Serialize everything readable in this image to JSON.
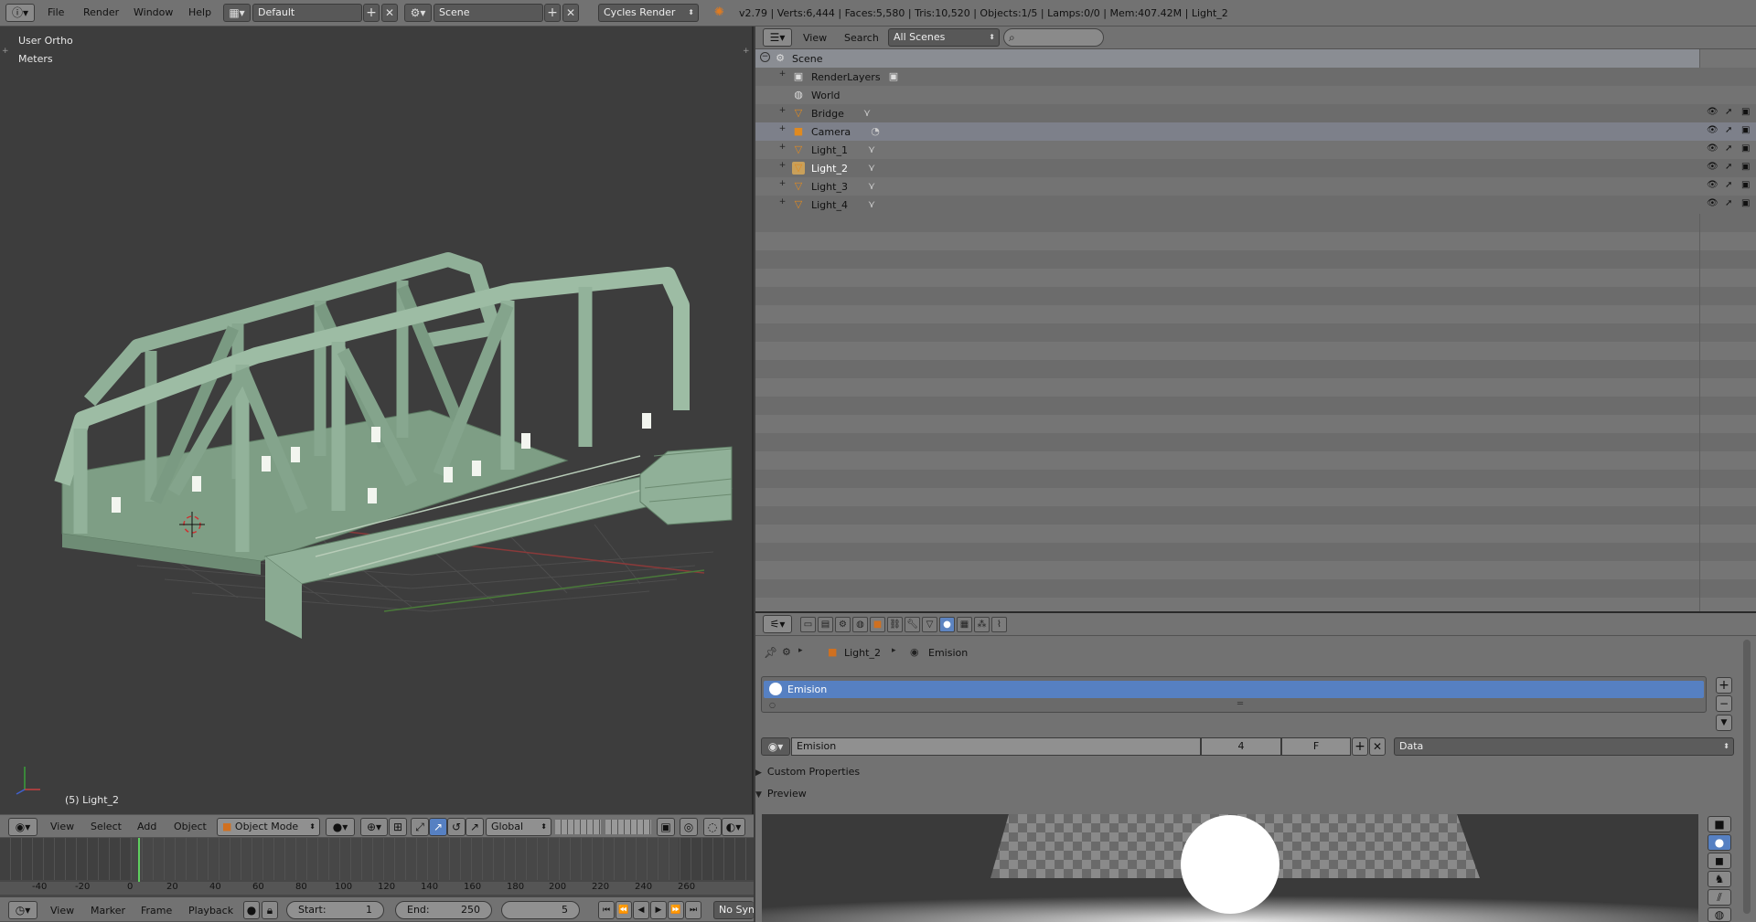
{
  "info_header": {
    "menus": [
      "File",
      "Render",
      "Window",
      "Help"
    ],
    "screen_layout": "Default",
    "scene": "Scene",
    "render_engine": "Cycles Render",
    "stats": "v2.79 | Verts:6,444 | Faces:5,580 | Tris:10,520 | Objects:1/5 | Lamps:0/0 | Mem:407.42M | Light_2"
  },
  "viewport": {
    "view_name": "User Ortho",
    "units": "Meters",
    "object_label": "(5) Light_2",
    "menus": [
      "View",
      "Select",
      "Add",
      "Object"
    ],
    "mode": "Object Mode",
    "orientation": "Global"
  },
  "outliner": {
    "menus": [
      "View",
      "Search"
    ],
    "display_mode": "All Scenes",
    "search_placeholder": "",
    "items": [
      {
        "label": "Scene",
        "icon": "scene-icon",
        "level": 0,
        "expanded": true
      },
      {
        "label": "RenderLayers",
        "icon": "renderlayers-icon",
        "level": 1
      },
      {
        "label": "World",
        "icon": "world-icon",
        "level": 1
      },
      {
        "label": "Bridge",
        "icon": "mesh-icon",
        "level": 1
      },
      {
        "label": "Camera",
        "icon": "camera-icon",
        "level": 1,
        "selected": true
      },
      {
        "label": "Light_1",
        "icon": "mesh-icon",
        "level": 1
      },
      {
        "label": "Light_2",
        "icon": "mesh-icon",
        "level": 1
      },
      {
        "label": "Light_3",
        "icon": "mesh-icon",
        "level": 1
      },
      {
        "label": "Light_4",
        "icon": "mesh-icon",
        "level": 1
      }
    ]
  },
  "properties": {
    "breadcrumb": [
      "Light_2",
      "Emision"
    ],
    "material_slots": [
      "Emision"
    ],
    "material_name": "Emision",
    "users": "4",
    "fake_user": "F",
    "link": "Data",
    "panels": {
      "custom_properties": "Custom Properties",
      "preview": "Preview"
    }
  },
  "timeline": {
    "ticks": [
      "-40",
      "-20",
      "0",
      "20",
      "40",
      "60",
      "80",
      "100",
      "120",
      "140",
      "160",
      "180",
      "200",
      "220",
      "240",
      "260"
    ],
    "menus": [
      "View",
      "Marker",
      "Frame",
      "Playback"
    ],
    "start_label": "Start:",
    "start": "1",
    "end_label": "End:",
    "end": "250",
    "current": "5",
    "sync": "No Sync"
  },
  "colors": {
    "accent": "#5680c2",
    "header": "#727272",
    "viewport_bg": "#3d3d3d",
    "bridge": "#8dae93"
  }
}
